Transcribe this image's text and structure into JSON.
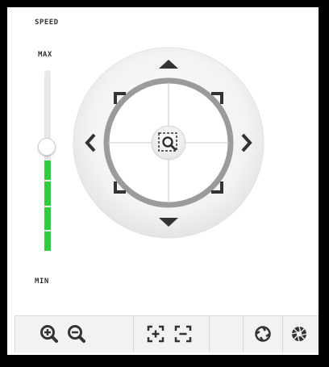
{
  "speed_panel": {
    "title": "SPEED",
    "max_label": "MAX",
    "min_label": "MIN",
    "speed_level": 0.45,
    "active_color": "#2ecc40"
  },
  "ptz_pad": {
    "directions": [
      "up",
      "down",
      "left",
      "right",
      "up-left",
      "up-right",
      "down-left",
      "down-right"
    ],
    "center_icon": "zoom-area-icon"
  },
  "toolbar": {
    "icons": [
      "zoom-in-icon",
      "zoom-out-icon",
      "focus-near-icon",
      "focus-far-icon",
      "iris-open-icon",
      "iris-close-icon"
    ]
  }
}
